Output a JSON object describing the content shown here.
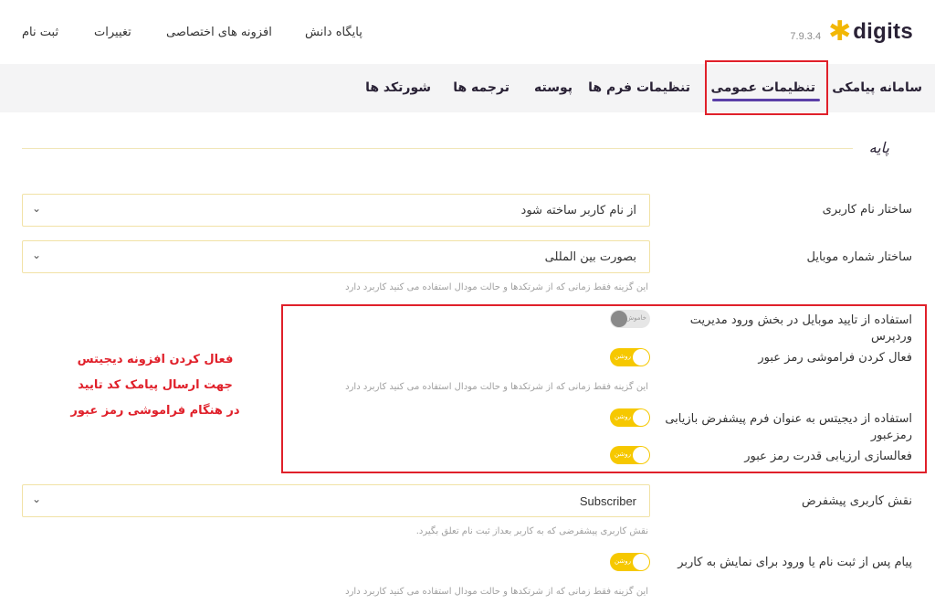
{
  "header": {
    "logo_text": "digits",
    "version": "7.9.3.4",
    "links": [
      "پایگاه دانش",
      "افزونه های اختصاصی",
      "تغییرات",
      "ثبت نام"
    ]
  },
  "tabs": [
    {
      "label": "سامانه پیامکی",
      "active": false
    },
    {
      "label": "تنظیمات عمومی",
      "active": true
    },
    {
      "label": "تنظیمات فرم ها",
      "active": false
    },
    {
      "label": "پوسته",
      "active": false
    },
    {
      "label": "ترجمه ها",
      "active": false
    },
    {
      "label": "شورتکد ها",
      "active": false
    }
  ],
  "section": {
    "title": "پایه"
  },
  "fields": {
    "username_structure": {
      "label": "ساختار نام کاربری",
      "value": "از نام کاربر ساخته شود"
    },
    "mobile_structure": {
      "label": "ساختار شماره موبایل",
      "value": "بصورت بین المللی",
      "hint": "این گزینه فقط زمانی که از شرتکدها و حالت مودال استفاده می کنید کاربرد دارد"
    },
    "wp_admin_mobile_verify": {
      "label": "استفاده از تایید موبایل در بخش ورود مدیریت وردپرس",
      "state": "off",
      "state_text": "خاموش"
    },
    "forgot_password": {
      "label": "فعال کردن فراموشی رمز عبور",
      "state": "on",
      "state_text": "روشن",
      "hint": "این گزینه فقط زمانی که از شرتکدها و حالت مودال استفاده می کنید کاربرد دارد"
    },
    "default_reset_form": {
      "label": "استفاده از دیجیتس به عنوان فرم پیشفرض بازیابی رمزعبور",
      "state": "on",
      "state_text": "روشن"
    },
    "password_strength": {
      "label": "فعالسازی ارزیابی قدرت رمز عبور",
      "state": "on",
      "state_text": "روشن"
    },
    "default_role": {
      "label": "نقش کاربری پیشفرض",
      "value": "Subscriber",
      "hint": "نقش کاربری پیشفرضی که به کاربر بعداز ثبت نام تعلق بگیرد."
    },
    "post_login_message": {
      "label": "پیام پس از ثبت نام یا ورود برای نمایش به کاربر",
      "state": "on",
      "state_text": "روشن",
      "hint": "این گزینه فقط زمانی که از شرتکدها و حالت مودال استفاده می کنید کاربرد دارد"
    }
  },
  "annotation": {
    "lines": [
      "فعال کردن افزونه دیجیتس",
      "جهت ارسال پیامک کد تایید",
      "در هنگام فراموشی رمز عبور"
    ],
    "color": "#e0202a"
  },
  "colors": {
    "accent": "#f6c800",
    "tab_underline": "#5b3fa8",
    "highlight": "#e0202a"
  }
}
